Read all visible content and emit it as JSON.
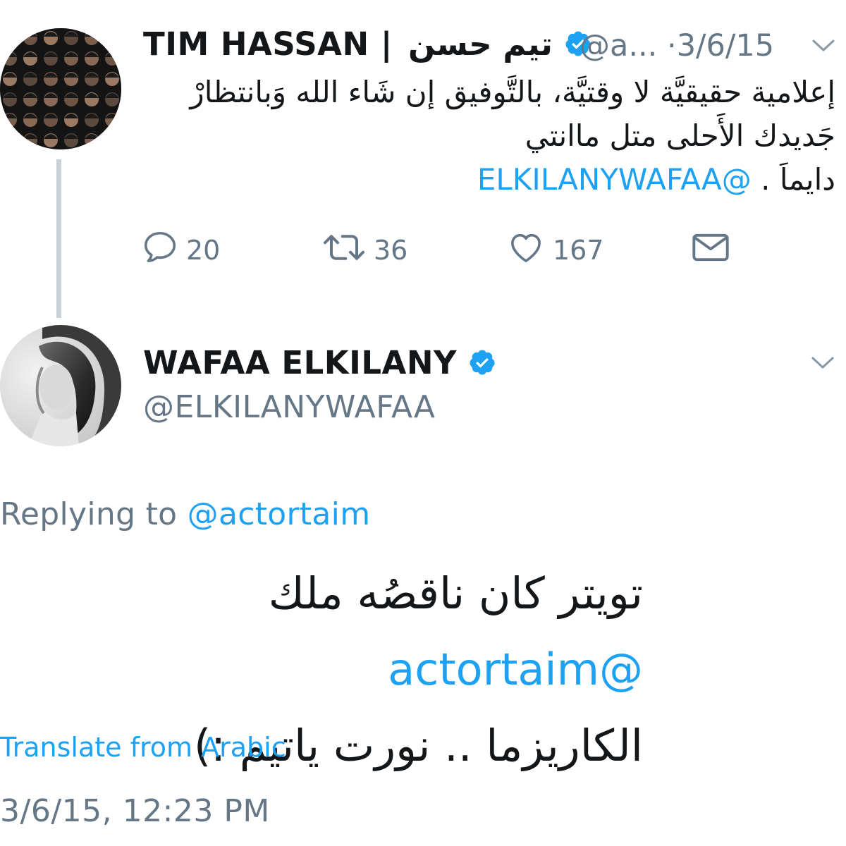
{
  "parent_tweet": {
    "name_latin": "TIM HASSAN |",
    "name_arabic": "تيم حسن",
    "handle_truncated": "@a...",
    "separator": "·",
    "date": "3/6/15",
    "body_line1": "إعلامية حقيقيَّة لا وقتيَّة، بالتَّوفيق إن شَاء الله وَبانتظارْ",
    "body_line2": "جَديدك الأَحلى متل ماانتي",
    "body_line3_text": "دايماَ .",
    "body_line3_mention": "@ELKILANYWAFAA",
    "actions": {
      "replies": "20",
      "retweets": "36",
      "likes": "167"
    }
  },
  "reply_tweet": {
    "name": "WAFAA ELKILANY",
    "handle": "@ELKILANYWAFAA",
    "replying_prefix": "Replying to",
    "replying_mention": "@actortaim",
    "body_mention": "@actortaim",
    "body_line1_text": "تويتر كان ناقصُه ملك",
    "body_line2": "الكاريزما .. نورت ياتيم :)",
    "translate_link": "Translate from Arabic",
    "timestamp": "3/6/15, 12:23 PM"
  },
  "icons": {
    "verified": "verified-badge-icon",
    "more": "chevron-down-icon",
    "reply": "reply-icon",
    "retweet": "retweet-icon",
    "like": "heart-icon",
    "dm": "envelope-icon"
  },
  "colors": {
    "accent": "#1da1f2",
    "muted": "#657786",
    "text": "#14171a",
    "thread_line": "#c9d1d8"
  }
}
